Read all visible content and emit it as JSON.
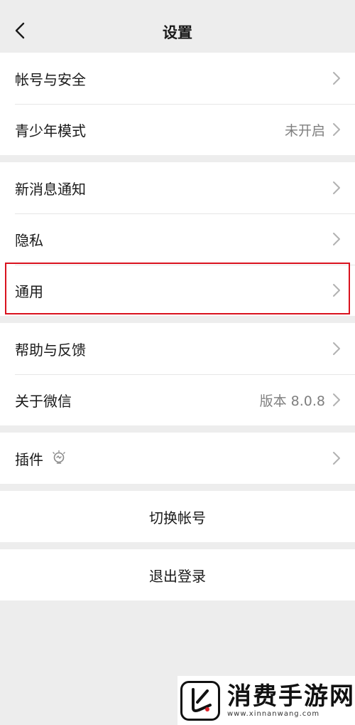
{
  "nav": {
    "title": "设置"
  },
  "groups": {
    "account": {
      "items": [
        {
          "label": "帐号与安全",
          "value": ""
        },
        {
          "label": "青少年模式",
          "value": "未开启"
        }
      ]
    },
    "notify": {
      "items": [
        {
          "label": "新消息通知"
        },
        {
          "label": "隐私"
        },
        {
          "label": "通用"
        }
      ]
    },
    "about": {
      "items": [
        {
          "label": "帮助与反馈",
          "value": ""
        },
        {
          "label": "关于微信",
          "value": "版本 8.0.8"
        }
      ]
    },
    "plugins": {
      "label": "插件"
    },
    "switch_account": {
      "label": "切换帐号"
    },
    "logout": {
      "label": "退出登录"
    }
  },
  "highlight": {
    "target": "通用",
    "color": "#d9121e"
  },
  "watermark": {
    "name": "消费手游网",
    "url": "www.xinnanwang.com"
  }
}
